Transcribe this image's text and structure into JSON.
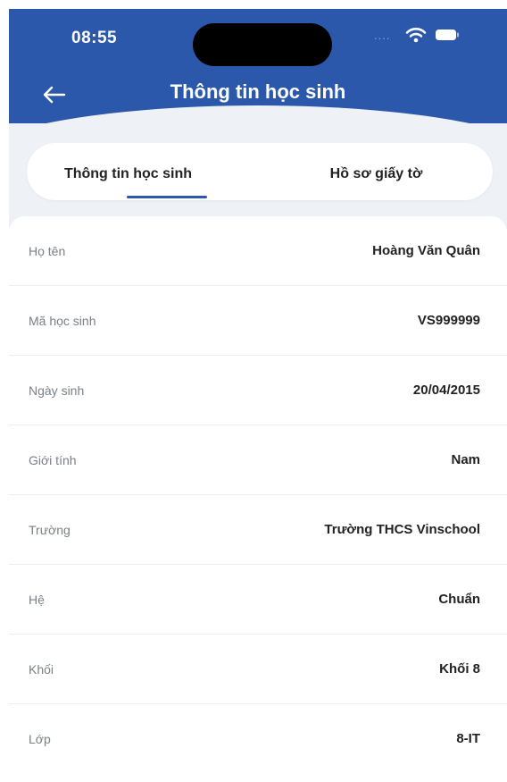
{
  "status_bar": {
    "time": "08:55",
    "signal_dots": "....",
    "wifi_icon": "wifi-icon",
    "battery_icon": "battery-icon"
  },
  "header": {
    "back_icon": "arrow-left-icon",
    "title": "Thông tin học sinh",
    "background_color": "#2b58ab"
  },
  "tabs": [
    {
      "label": "Thông tin học sinh",
      "active": true
    },
    {
      "label": "Hồ sơ giấy tờ",
      "active": false
    }
  ],
  "student_info": [
    {
      "label": "Họ tên",
      "value": "Hoàng Văn Quân"
    },
    {
      "label": "Mã học sinh",
      "value": "VS999999"
    },
    {
      "label": "Ngày sinh",
      "value": "20/04/2015"
    },
    {
      "label": "Giới tính",
      "value": "Nam"
    },
    {
      "label": "Trường",
      "value": "Trường THCS Vinschool"
    },
    {
      "label": "Hệ",
      "value": "Chuẩn"
    },
    {
      "label": "Khối",
      "value": "Khối 8"
    },
    {
      "label": "Lớp",
      "value": "8-IT"
    }
  ]
}
